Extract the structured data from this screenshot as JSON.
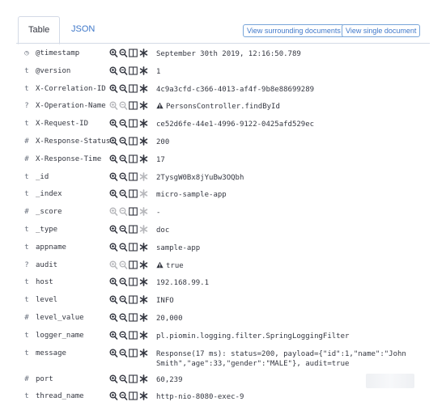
{
  "tabs": {
    "table": "Table",
    "json": "JSON"
  },
  "buttons": {
    "surrounding": "View surrounding documents",
    "single": "View single document"
  },
  "rows": [
    {
      "type": "◷",
      "name": "@timestamp",
      "value": "September 30th 2019, 12:16:50.789",
      "warn": false,
      "dim_filter": false,
      "dim_exists": false
    },
    {
      "type": "t",
      "name": "@version",
      "value": "1",
      "warn": false,
      "dim_filter": false,
      "dim_exists": false
    },
    {
      "type": "t",
      "name": "X-Correlation-ID",
      "value": "4c9a3cfd-c366-4013-af4f-9b8e88699289",
      "warn": false,
      "dim_filter": false,
      "dim_exists": false
    },
    {
      "type": "?",
      "name": "X-Operation-Name",
      "value": "PersonsController.findById",
      "warn": true,
      "dim_filter": true,
      "dim_exists": false
    },
    {
      "type": "t",
      "name": "X-Request-ID",
      "value": "ce52d6fe-44e1-4996-9122-0425afd529ec",
      "warn": false,
      "dim_filter": false,
      "dim_exists": false
    },
    {
      "type": "#",
      "name": "X-Response-Status",
      "value": "200",
      "warn": false,
      "dim_filter": false,
      "dim_exists": false
    },
    {
      "type": "#",
      "name": "X-Response-Time",
      "value": "17",
      "warn": false,
      "dim_filter": false,
      "dim_exists": false
    },
    {
      "type": "t",
      "name": "_id",
      "value": "2TysgW0Bx8jYuBw3OQbh",
      "warn": false,
      "dim_filter": false,
      "dim_exists": true
    },
    {
      "type": "t",
      "name": "_index",
      "value": "micro-sample-app",
      "warn": false,
      "dim_filter": false,
      "dim_exists": true
    },
    {
      "type": "#",
      "name": "_score",
      "value": "-",
      "warn": false,
      "dim_filter": true,
      "dim_exists": true
    },
    {
      "type": "t",
      "name": "_type",
      "value": "doc",
      "warn": false,
      "dim_filter": false,
      "dim_exists": true
    },
    {
      "type": "t",
      "name": "appname",
      "value": "sample-app",
      "warn": false,
      "dim_filter": false,
      "dim_exists": false
    },
    {
      "type": "?",
      "name": "audit",
      "value": "true",
      "warn": true,
      "dim_filter": true,
      "dim_exists": false
    },
    {
      "type": "t",
      "name": "host",
      "value": "192.168.99.1",
      "warn": false,
      "dim_filter": false,
      "dim_exists": false
    },
    {
      "type": "t",
      "name": "level",
      "value": "INFO",
      "warn": false,
      "dim_filter": false,
      "dim_exists": false
    },
    {
      "type": "#",
      "name": "level_value",
      "value": "20,000",
      "warn": false,
      "dim_filter": false,
      "dim_exists": false
    },
    {
      "type": "t",
      "name": "logger_name",
      "value": "pl.piomin.logging.filter.SpringLoggingFilter",
      "warn": false,
      "dim_filter": false,
      "dim_exists": false
    },
    {
      "type": "t",
      "name": "message",
      "value": "Response(17 ms): status=200, payload={\"id\":1,\"name\":\"John Smith\",\"age\":33,\"gender\":\"MALE\"}, audit=true",
      "warn": false,
      "dim_filter": false,
      "dim_exists": false,
      "tall": true
    },
    {
      "type": "#",
      "name": "port",
      "value": "60,239",
      "warn": false,
      "dim_filter": false,
      "dim_exists": false
    },
    {
      "type": "t",
      "name": "thread_name",
      "value": "http-nio-8080-exec-9",
      "warn": false,
      "dim_filter": false,
      "dim_exists": false
    }
  ],
  "colors": {
    "link": "#3f78c9",
    "border": "#d3dae6",
    "text": "#343741",
    "icon": "#343741"
  },
  "icons": {
    "filter_in": "magnifier-plus-icon",
    "filter_out": "magnifier-minus-icon",
    "toggle_column": "column-icon",
    "filter_exists": "asterisk-icon",
    "warning": "warning-triangle-icon"
  }
}
